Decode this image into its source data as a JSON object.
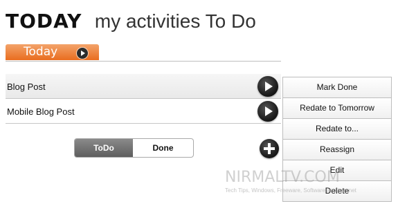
{
  "header": {
    "brand": "TODAY",
    "subtitle": "my activities To Do"
  },
  "tabs": [
    {
      "label": "Today",
      "active": true
    }
  ],
  "tasks": [
    {
      "label": "Blog Post",
      "selected": true
    },
    {
      "label": "Mobile Blog Post",
      "selected": false
    }
  ],
  "filter": {
    "todo_label": "ToDo",
    "done_label": "Done",
    "selected": "ToDo"
  },
  "context_menu": {
    "items": [
      "Mark Done",
      "Redate to Tomorrow",
      "Redate to...",
      "Reassign",
      "Edit",
      "Delete"
    ]
  },
  "watermark": {
    "main": "NIRMALTV.COM",
    "sub": "Tech Tips, Windows, Freeware, Software and Internet"
  },
  "colors": {
    "accent_orange": "#e96d1f",
    "selected_segment": "#6e6e6e",
    "button_dark": "#222222"
  },
  "icons": {
    "tab_arrow": "play-circle-icon",
    "row_arrow": "play-circle-icon",
    "add": "plus-circle-icon"
  }
}
